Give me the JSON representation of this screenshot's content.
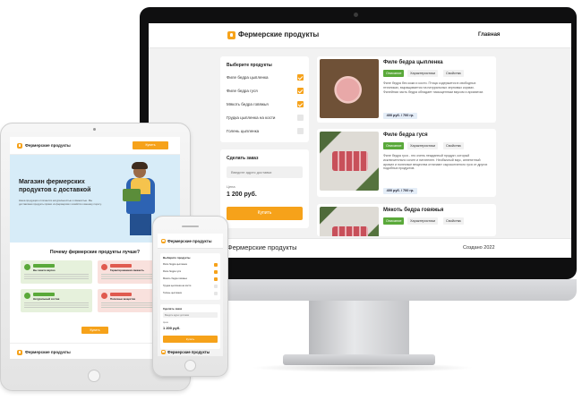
{
  "brand": "Фермерские продукты",
  "desktop": {
    "nav_home": "Главная",
    "filter": {
      "title": "Выберите продукты",
      "items": [
        {
          "label": "Филе бедра цыпленка",
          "checked": true
        },
        {
          "label": "Филе бедра гуся",
          "checked": true
        },
        {
          "label": "Мякоть бедра говяжья",
          "checked": true
        },
        {
          "label": "Грудка цыпленка на кости",
          "checked": false
        },
        {
          "label": "Голень цыпленка",
          "checked": false
        }
      ]
    },
    "order": {
      "title": "Сделать заказ",
      "address_placeholder": "Введите адрес доставки",
      "price_label": "Цена",
      "price": "1 200 руб.",
      "buy_label": "Купить"
    },
    "products": [
      {
        "name": "Филе бедра цыпленка",
        "tabs": [
          "Описание",
          "Характеристики",
          "Свойства"
        ],
        "description": "Филе бедра без кожи и кости. Птица содержится в свободных птичниках, выращивается на натуральных зерновых кормах. Филейная часть бедра обладает насыщенным вкусом и ароматом.",
        "price": "400 руб. / 700 гр."
      },
      {
        "name": "Филе бедра гуся",
        "tabs": [
          "Описание",
          "Характеристики",
          "Свойства"
        ],
        "description": "Филе бедра гуся - это очень нежданный продукт, который исключительно сочен и питателен. Необычный вкус, аппетитный аромат и полезные вещества отличают сырокопченого гуся от других подобных продуктов.",
        "price": "400 руб. / 700 гр."
      },
      {
        "name": "Мякоть бедра говяжья",
        "tabs": [
          "Описание",
          "Характеристики",
          "Свойства"
        ]
      }
    ],
    "footer": {
      "copyright": "Создано 2022"
    }
  },
  "tablet": {
    "header_cta": "Купить",
    "hero_title": "Магазин фермерских продуктов с доставкой",
    "hero_text": "Наша продукция отличается натуральностью и свежестью. Мы доставляем продукты прямо из фермерских хозяйств к вашему порогу.",
    "why_title": "Почему фермерские продукты лучше?",
    "advantages": [
      {
        "title": "Вы знаете вкусно",
        "tone": "green"
      },
      {
        "title": "Гарантированная свежесть",
        "tone": "red"
      },
      {
        "title": "Натуральный состав",
        "tone": "green"
      },
      {
        "title": "Полезные вещества",
        "tone": "red"
      }
    ],
    "cta": "Купить"
  },
  "mobile": {
    "filter_title": "Выберите продукты",
    "items": [
      {
        "label": "Филе бедра цыпленка",
        "checked": true
      },
      {
        "label": "Филе бедра гуся",
        "checked": true
      },
      {
        "label": "Мякоть бедра говяжья",
        "checked": true
      },
      {
        "label": "Грудка цыпленка на кости",
        "checked": false
      },
      {
        "label": "Голень цыпленка",
        "checked": false
      }
    ],
    "order_title": "Сделать заказ",
    "address_placeholder": "Введите адрес доставки",
    "price_label": "Цена",
    "price": "1 200 руб.",
    "buy_label": "Купить"
  },
  "colors": {
    "accent": "#f6a21a",
    "active_tab": "#5aa93a",
    "hero_bg": "#d7ecf8"
  }
}
